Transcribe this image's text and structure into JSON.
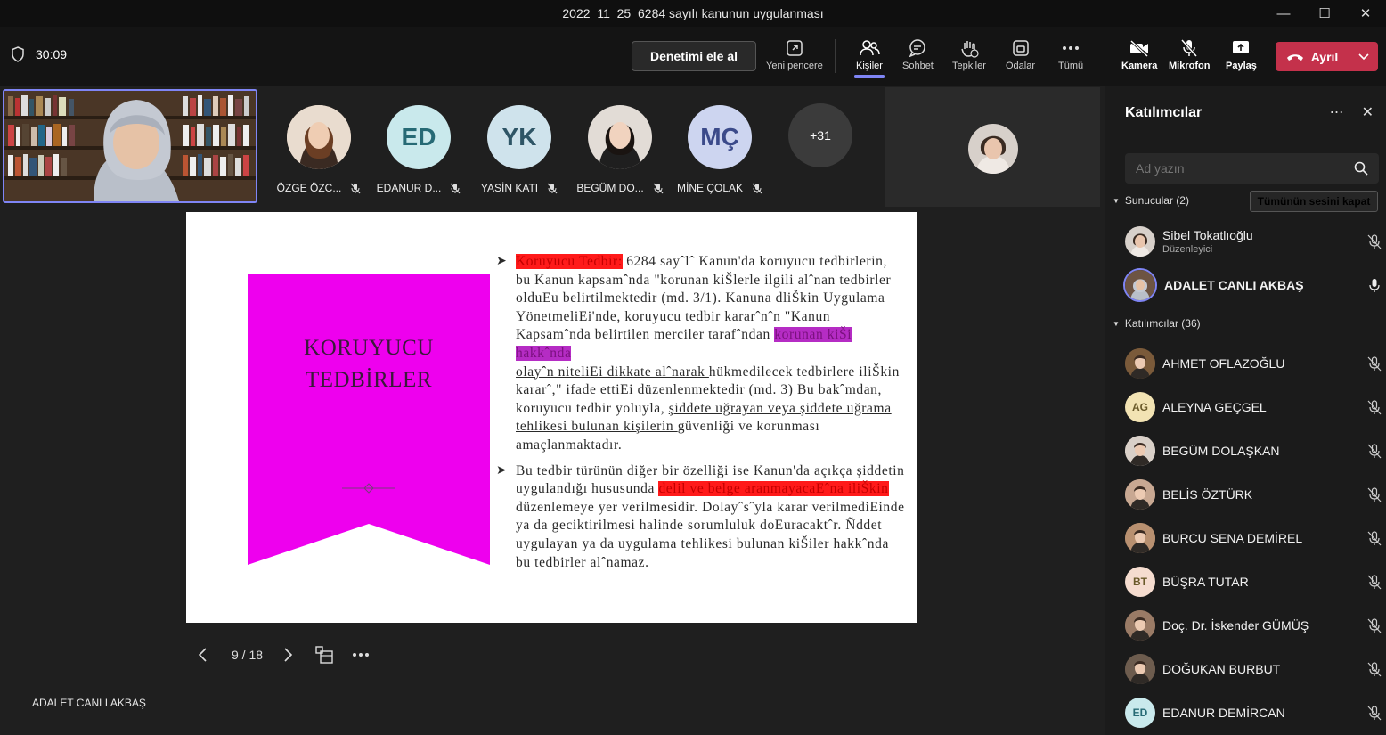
{
  "window": {
    "title": "2022_11_25_6284 sayılı kanunun uygulanması"
  },
  "toolbar": {
    "timer": "30:09",
    "take_control": "Denetimi ele al",
    "tools": {
      "new_window": "Yeni pencere",
      "people": "Kişiler",
      "chat": "Sohbet",
      "reactions": "Tepkiler",
      "rooms": "Odalar",
      "more": "Tümü",
      "camera": "Kamera",
      "mic": "Mikrofon",
      "share": "Paylaş"
    },
    "leave": "Ayrıl"
  },
  "gallery": {
    "participants": [
      {
        "name": "ÖZGE ÖZC...",
        "initials": "",
        "color": "#c98a5e"
      },
      {
        "name": "EDANUR D...",
        "initials": "ED",
        "color": "#c9e9ec"
      },
      {
        "name": "YASİN KATI",
        "initials": "YK",
        "color": "#cfe3ec"
      },
      {
        "name": "BEGÜM DO...",
        "initials": "",
        "color": "#d9d0c8"
      },
      {
        "name": "MİNE ÇOLAK",
        "initials": "MÇ",
        "color": "#cdd5f0"
      }
    ],
    "overflow": "+31"
  },
  "slide": {
    "title_line1": "KORUYUCU",
    "title_line2": "TEDBİRLER",
    "b1_hl": "Koruyucu Tedbir:",
    "b1_a": " 6284 sayˆlˆ Kanun'da koruyucu tedbirlerin, bu Kanun kapsamˆnda \"korunan kiŠlerle ilgili alˆnan tedbirler olduEu belirtilmektedir (md. 3/1). Kanuna dliŠkin Uygulama YönetmeliEi'nde, koruyucu tedbir kararˆnˆn \"Kanun Kapsamˆnda belirtilen merciler tarafˆndan ",
    "b1_mag": "korunan kiŠi hakkˆnda",
    "b1_u1": "olayˆn niteliEi dikkate alˆnarak ",
    "b1_b": "hükmedilecek tedbirlere iliŠkin kararˆ,\" ifade ettiEi düzenlenmektedir (md. 3) Bu bakˆmdan, koruyucu tedbir yoluyla, ",
    "b1_u2": "şiddete uğrayan veya şiddete uğrama tehlikesi bulunan kişilerin ",
    "b1_c": "güvenliği ve korunması amaçlanmaktadır.",
    "b2_a": "Bu tedbir türünün diğer bir özelliği ise Kanun'da açıkça şiddetin uygulandığı hususunda ",
    "b2_hl": "delil ve belge aranmayacaEˆna iliŠkin",
    "b2_b": " düzenlemeye yer verilmesidir. Dolayˆsˆyla karar verilmediEinde ya da geciktirilmesi halinde sorumluluk doEuracaktˆr. Ñddet uygulayan ya da uygulama tehlikesi bulunan kiŠiler hakkˆnda bu tedbirler alˆnamaz."
  },
  "slide_nav": {
    "page": "9 / 18"
  },
  "presenter": "ADALET CANLI AKBAŞ",
  "panel": {
    "title": "Katılımcılar",
    "search_placeholder": "Ad yazın",
    "presenters_header": "Sunucular (2)",
    "mute_all": "Tümünün sesini kapat",
    "attendees_header": "Katılımcılar (36)",
    "presenters": [
      {
        "name": "Sibel Tokatlıoğlu",
        "role": "Düzenleyici"
      },
      {
        "name": "ADALET CANLI AKBAŞ",
        "role": ""
      }
    ],
    "attendees": [
      {
        "name": "AHMET OFLAZOĞLU",
        "initials": "",
        "color": "#7a5a3a"
      },
      {
        "name": "ALEYNA GEÇGEL",
        "initials": "AG",
        "color": "#f2e3b3"
      },
      {
        "name": "BEGÜM DOLAŞKAN",
        "initials": "",
        "color": "#d9d0c8"
      },
      {
        "name": "BELİS ÖZTÜRK",
        "initials": "",
        "color": "#c8a892"
      },
      {
        "name": "BURCU SENA DEMİREL",
        "initials": "",
        "color": "#b89070"
      },
      {
        "name": "BÜŞRA TUTAR",
        "initials": "BT",
        "color": "#f5dccf"
      },
      {
        "name": "Doç. Dr. İskender GÜMÜŞ",
        "initials": "",
        "color": "#9a7b66"
      },
      {
        "name": "DOĞUKAN BURBUT",
        "initials": "",
        "color": "#6d5c4e"
      },
      {
        "name": "EDANUR DEMİRCAN",
        "initials": "ED",
        "color": "#c9e9ec"
      }
    ]
  }
}
